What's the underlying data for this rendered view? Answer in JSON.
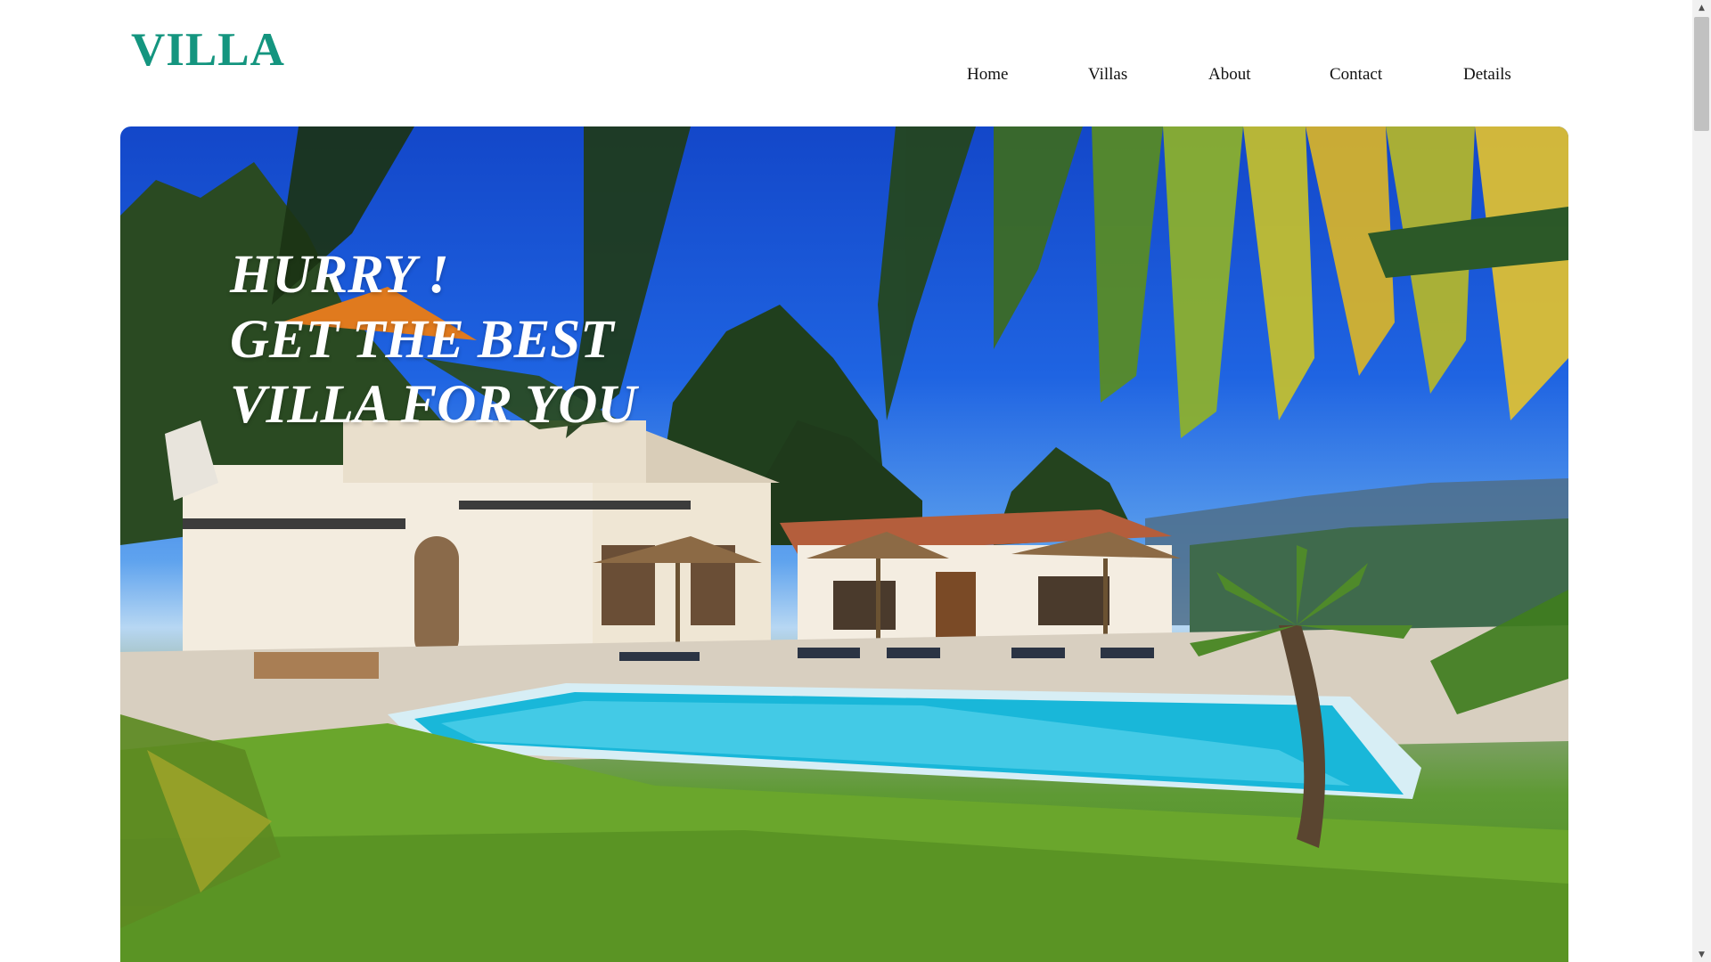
{
  "header": {
    "logo": "VILLA",
    "nav": [
      "Home",
      "Villas",
      "About",
      "Contact",
      "Details"
    ]
  },
  "hero": {
    "headline": [
      "HURRY !",
      "GET THE BEST",
      "VILLA FOR YOU"
    ]
  },
  "scrollbar": {
    "up_icon": "chevron-up-icon",
    "down_icon": "chevron-down-icon"
  },
  "colors": {
    "brand": "#14957f",
    "nav_text": "#111111",
    "headline": "#ffffff"
  }
}
